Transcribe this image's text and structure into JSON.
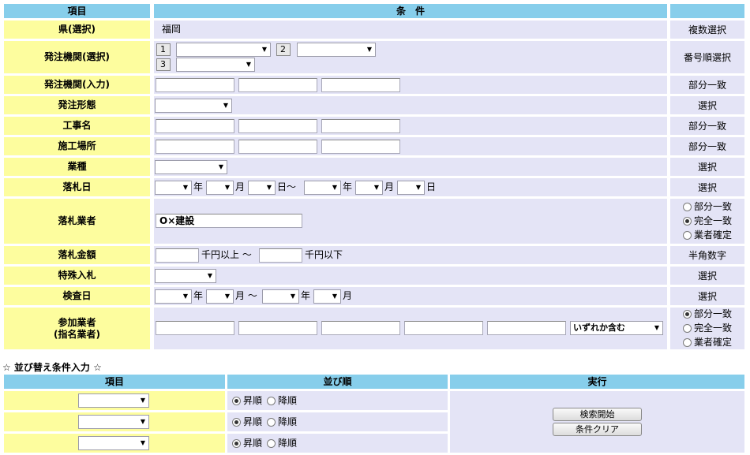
{
  "header": {
    "item": "項目",
    "condition": "条　件",
    "note": ""
  },
  "rows": [
    {
      "label": "県(選択)",
      "note": "複数選択",
      "value": "福岡"
    },
    {
      "label": "発注機関(選択)",
      "note": "番号順選択",
      "nums": [
        "1",
        "2",
        "3"
      ]
    },
    {
      "label": "発注機関(入力)",
      "note": "部分一致"
    },
    {
      "label": "発注形態",
      "note": "選択"
    },
    {
      "label": "工事名",
      "note": "部分一致"
    },
    {
      "label": "施工場所",
      "note": "部分一致"
    },
    {
      "label": "業種",
      "note": "選択"
    },
    {
      "label": "落札日",
      "note": "選択",
      "units": [
        "年",
        "月",
        "日～",
        "年",
        "月",
        "日"
      ]
    },
    {
      "label": "落札業者",
      "note": "",
      "value": "O×建設",
      "options": [
        "部分一致",
        "完全一致",
        "業者確定"
      ]
    },
    {
      "label": "落札金額",
      "note": "半角数字",
      "from_unit": "千円以上 ～",
      "to_unit": "千円以下"
    },
    {
      "label": "特殊入札",
      "note": "選択"
    },
    {
      "label": "検査日",
      "note": "選択",
      "units": [
        "年",
        "月 ～",
        "年",
        "月"
      ]
    },
    {
      "label": "参加業者\n(指名業者)",
      "note": "",
      "match_select": "いずれか含む",
      "options": [
        "部分一致",
        "完全一致",
        "業者確定"
      ]
    }
  ],
  "sort_section": {
    "title": "☆ 並び替え条件入力 ☆",
    "headers": {
      "item": "項目",
      "order": "並び順",
      "exec": "実行"
    },
    "asc": "昇順",
    "desc": "降順",
    "search_button": "検索開始",
    "clear_button": "条件クリア"
  }
}
